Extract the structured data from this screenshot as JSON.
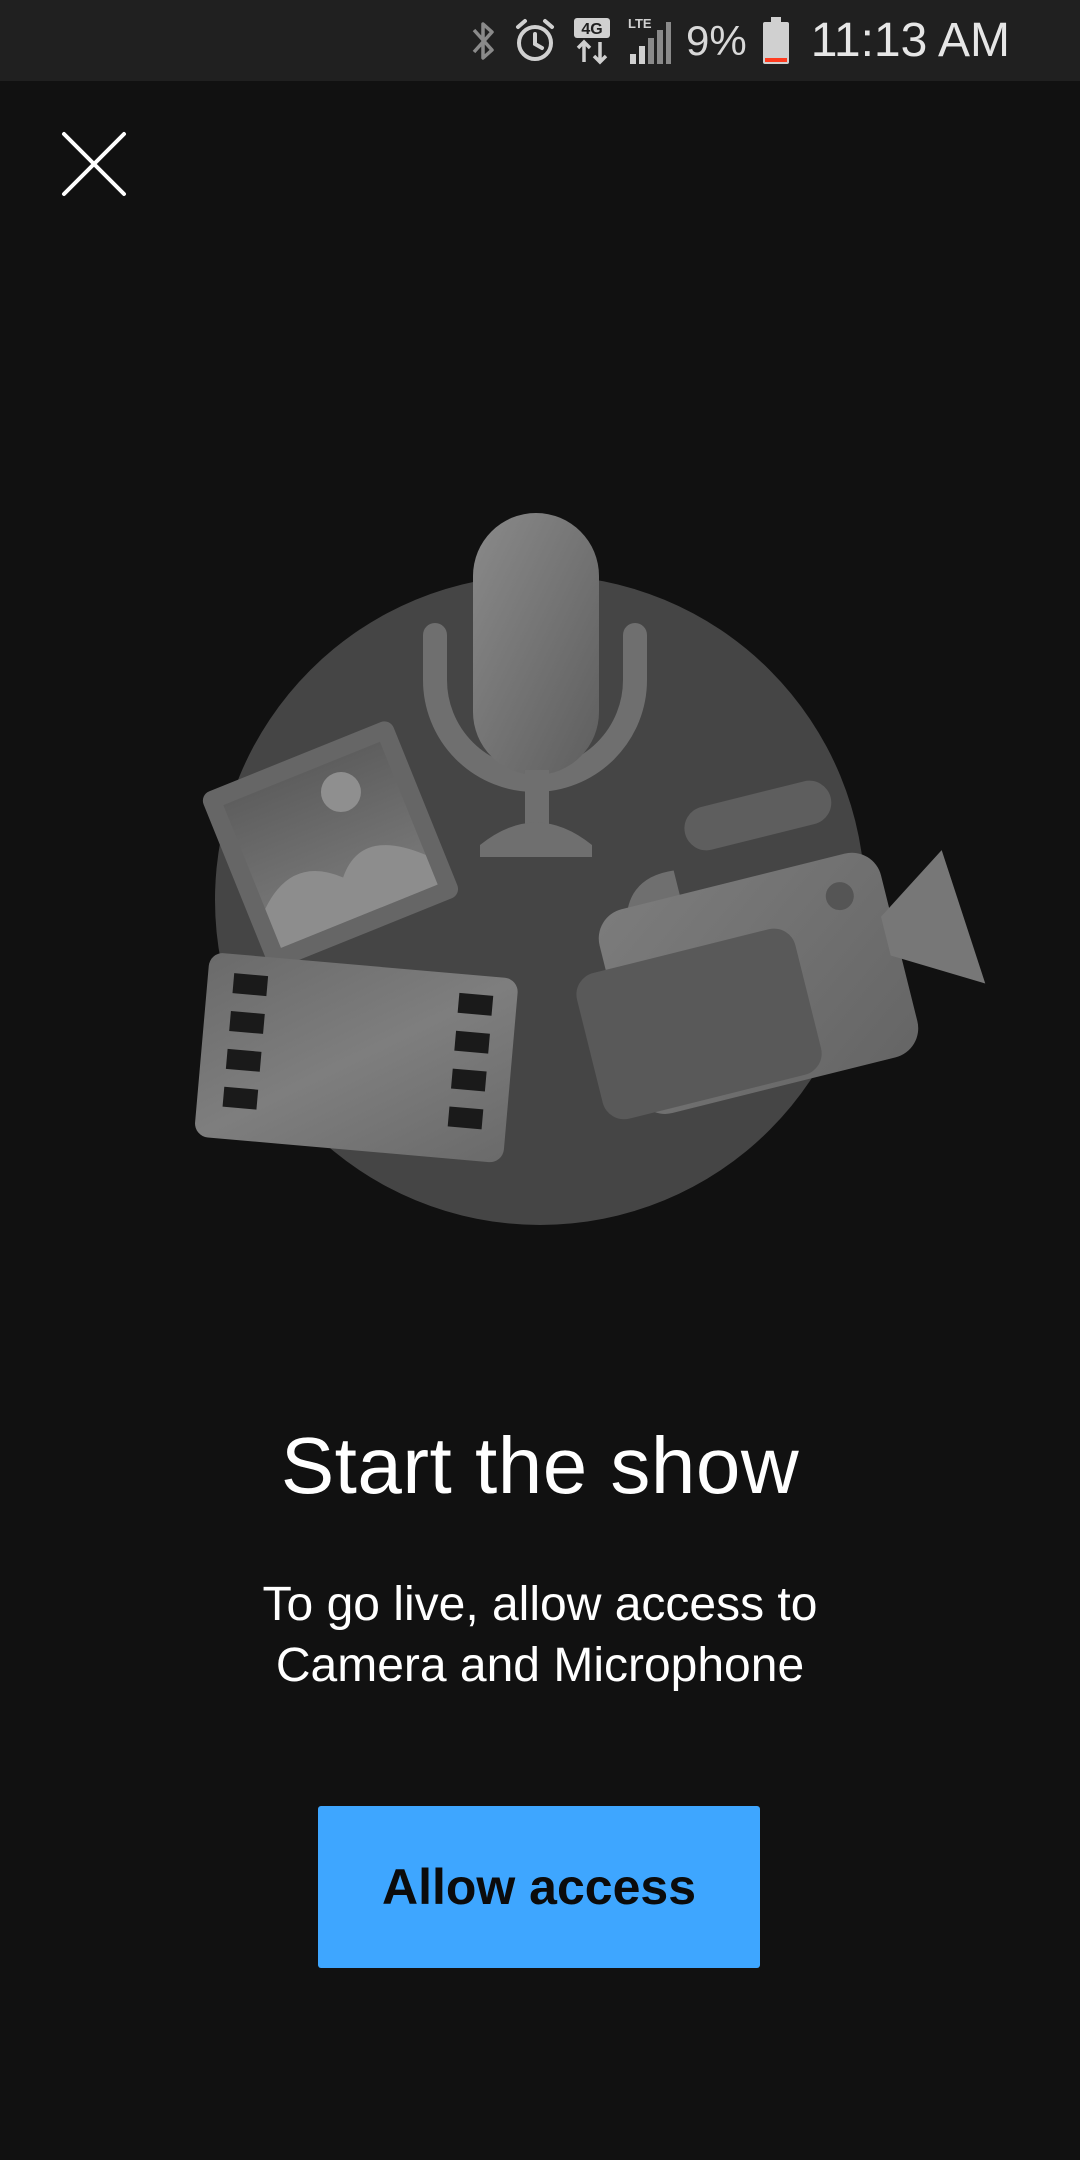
{
  "status_bar": {
    "battery_percent": "9%",
    "time": "11:13 AM",
    "network_label": "4G",
    "lte_label": "LTE",
    "battery_level": 0.09,
    "battery_low_color": "#ff3b1f",
    "icons": [
      "bluetooth-icon",
      "alarm-icon",
      "4g-data-icon",
      "lte-signal-icon",
      "battery-icon"
    ]
  },
  "close": {
    "icon": "close-icon"
  },
  "illustration": {
    "icons": [
      "microphone-icon",
      "photo-icon",
      "film-strip-icon",
      "video-camera-icon"
    ]
  },
  "content": {
    "title": "Start the show",
    "subtitle_line1": "To go live, allow access to",
    "subtitle_line2": "Camera and Microphone"
  },
  "actions": {
    "allow_label": "Allow access",
    "accent_color": "#3ea6ff"
  }
}
